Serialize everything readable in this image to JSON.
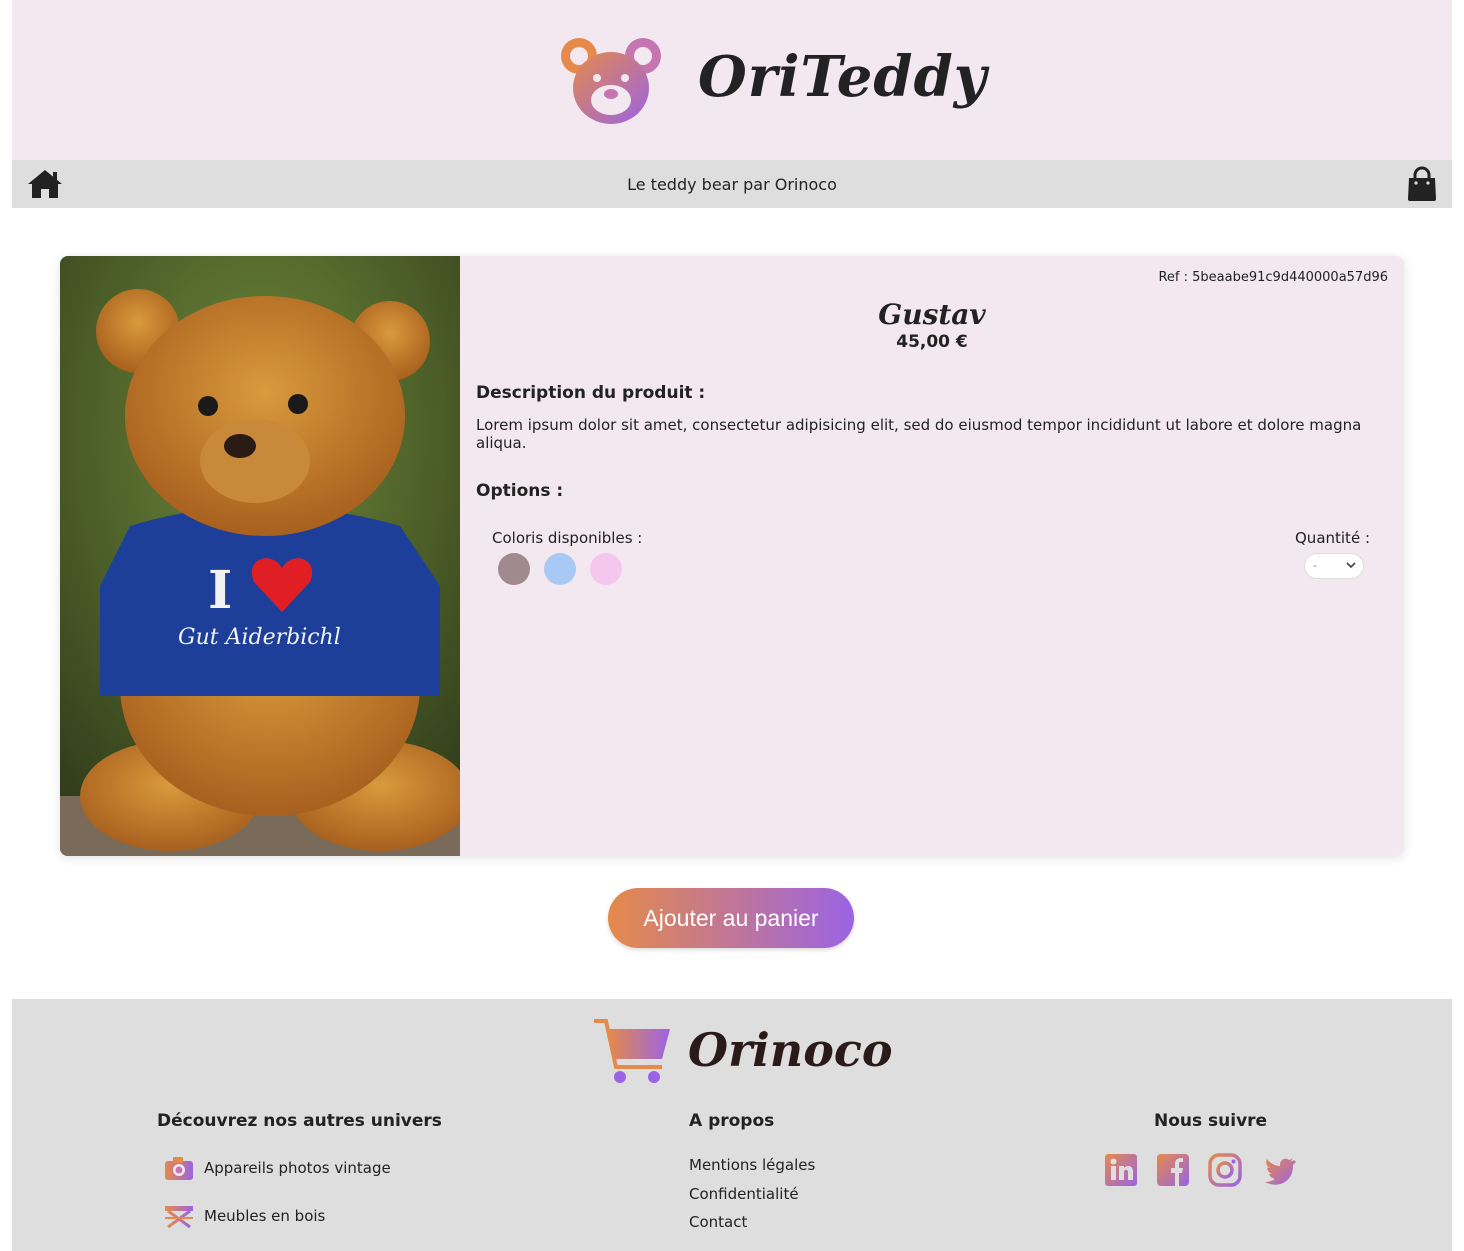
{
  "header": {
    "brand": "OriTeddy"
  },
  "nav": {
    "tagline": "Le teddy bear par Orinoco",
    "home_icon": "home-icon",
    "cart_icon": "shopping-bag-icon"
  },
  "product": {
    "ref": "Ref : 5beaabe91c9d440000a57d96",
    "name": "Gustav",
    "price": "45,00 €",
    "description_title": "Description du produit :",
    "description": "Lorem ipsum dolor sit amet, consectetur adipisicing elit, sed do eiusmod tempor incididunt ut labore et dolore magna aliqua.",
    "options_title": "Options :",
    "colors_label": "Coloris disponibles :",
    "colors": [
      "#a08a8e",
      "#a9c9f5",
      "#f4c7ef"
    ],
    "quantity_label": "Quantité :",
    "quantity_value": "-",
    "photo_shirt_text": "I",
    "photo_shirt_caption": "Gut Aiderbichl"
  },
  "actions": {
    "add_to_cart": "Ajouter au panier"
  },
  "footer": {
    "brand": "Orinoco",
    "col1": {
      "title": "Découvrez nos autres univers",
      "items": [
        "Appareils photos vintage",
        "Meubles en bois"
      ]
    },
    "col2": {
      "title": "A propos",
      "items": [
        "Mentions légales",
        "Confidentialité",
        "Contact"
      ]
    },
    "col3": {
      "title": "Nous suivre",
      "icons": [
        "linkedin-icon",
        "facebook-icon",
        "instagram-icon",
        "twitter-icon"
      ]
    }
  },
  "colors": {
    "header_bg": "#f3e8ef",
    "nav_bg": "#dedede",
    "gradient_start": "#e58a4a",
    "gradient_end": "#9b63e4"
  }
}
